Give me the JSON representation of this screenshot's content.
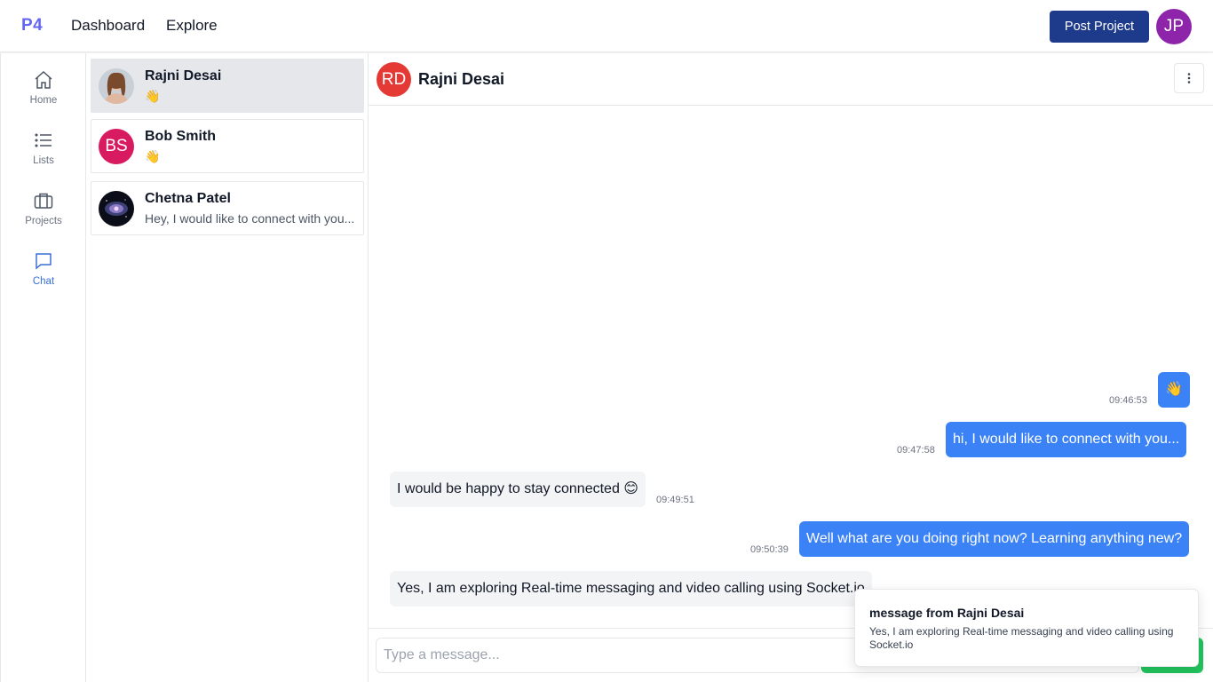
{
  "topbar": {
    "logo": "P4",
    "nav": [
      "Dashboard",
      "Explore"
    ],
    "post_button": "Post Project",
    "user_initials": "JP",
    "user_avatar_color": "#8e24aa"
  },
  "rail": {
    "items": [
      {
        "label": "Home",
        "icon": "home-icon"
      },
      {
        "label": "Lists",
        "icon": "list-icon"
      },
      {
        "label": "Projects",
        "icon": "briefcase-icon"
      },
      {
        "label": "Chat",
        "icon": "chat-bubble-icon",
        "active": true
      }
    ],
    "active_color": "#3b6fd9"
  },
  "conversations": [
    {
      "name": "Rajni Desai",
      "preview": "👋",
      "avatar": "photo",
      "active": true
    },
    {
      "name": "Bob Smith",
      "preview": "👋",
      "avatar_initials": "BS",
      "avatar_color": "#d81b60"
    },
    {
      "name": "Chetna Patel",
      "preview": "Hey, I would like to connect with you...",
      "avatar": "photo"
    }
  ],
  "chat": {
    "contact_name": "Rajni Desai",
    "contact_initials": "RD",
    "contact_avatar_color": "#e53935",
    "messages": [
      {
        "direction": "out",
        "text": "👋",
        "time": "09:46:53"
      },
      {
        "direction": "out",
        "text": "hi, I would like to connect with you...",
        "time": "09:47:58"
      },
      {
        "direction": "in",
        "text": "I would be happy to stay connected 😊",
        "time": "09:49:51"
      },
      {
        "direction": "out",
        "text": "Well what are you doing right now? Learning anything new?",
        "time": "09:50:39"
      },
      {
        "direction": "in",
        "text": "Yes, I am exploring Real-time messaging and video calling using Socket.io",
        "time": ""
      }
    ],
    "input_placeholder": "Type a message...",
    "outgoing_color": "#3b82f6",
    "incoming_color": "#f3f4f6",
    "send_color": "#22c55e"
  },
  "toast": {
    "title": "message from Rajni Desai",
    "body": "Yes, I am exploring Real-time messaging and video calling using Socket.io"
  }
}
